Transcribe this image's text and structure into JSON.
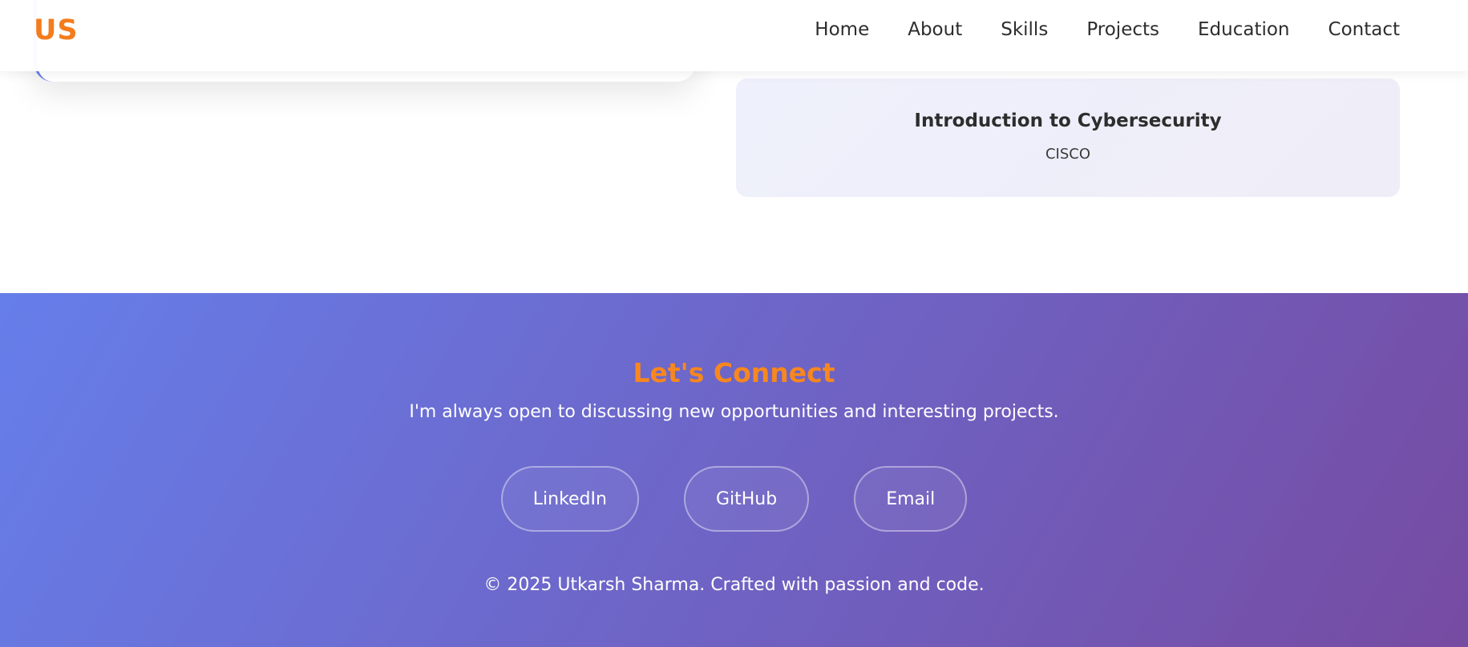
{
  "navbar": {
    "logo": "US",
    "links": [
      "Home",
      "About",
      "Skills",
      "Projects",
      "Education",
      "Contact"
    ]
  },
  "certification": {
    "title": "Introduction to Cybersecurity",
    "issuer": "CISCO"
  },
  "footer": {
    "title": "Let's Connect",
    "subtitle": "I'm always open to discussing new opportunities and interesting projects.",
    "social": [
      "LinkedIn",
      "GitHub",
      "Email"
    ],
    "copyright": "© 2025 Utkarsh Sharma. Crafted with passion and code."
  },
  "colors": {
    "accent_orange": "#f47c1c",
    "gradient_start": "#667eea",
    "gradient_end": "#764ba2"
  }
}
